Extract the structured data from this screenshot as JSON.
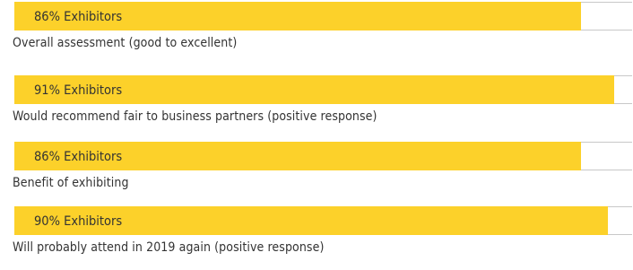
{
  "chart_data": {
    "type": "bar",
    "orientation": "horizontal",
    "xlim": [
      0,
      100
    ],
    "unit": "%",
    "items": [
      {
        "value": 86,
        "bar_label": "86% Exhibitors",
        "category": "Overall assessment (good to excellent)"
      },
      {
        "value": 91,
        "bar_label": "91% Exhibitors",
        "category": "Would recommend fair to business partners (positive response)"
      },
      {
        "value": 86,
        "bar_label": "86% Exhibitors",
        "category": "Benefit of exhibiting"
      },
      {
        "value": 90,
        "bar_label": "90% Exhibitors",
        "category": "Will probably attend in 2019 again (positive response)"
      }
    ],
    "colors": {
      "bar": "#fcd12a",
      "track_border": "#c8c8c8"
    }
  }
}
